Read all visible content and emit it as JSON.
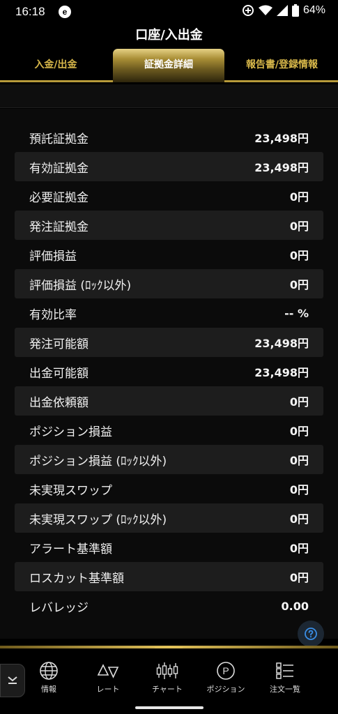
{
  "status": {
    "time": "16:18",
    "app_badge": "e",
    "battery": "64%"
  },
  "header": {
    "title": "口座/入出金"
  },
  "tabs": [
    {
      "label": "入金/出金"
    },
    {
      "label": "証拠金詳細"
    },
    {
      "label": "報告書/登録情報"
    }
  ],
  "rows": [
    {
      "label": "預託証拠金",
      "value": "23,498円"
    },
    {
      "label": "有効証拠金",
      "value": "23,498円"
    },
    {
      "label": "必要証拠金",
      "value": "0円"
    },
    {
      "label": "発注証拠金",
      "value": "0円"
    },
    {
      "label": "評価損益",
      "value": "0円"
    },
    {
      "label": "評価損益 (ﾛｯｸ以外)",
      "value": "0円"
    },
    {
      "label": "有効比率",
      "value": "-- %"
    },
    {
      "label": "発注可能額",
      "value": "23,498円"
    },
    {
      "label": "出金可能額",
      "value": "23,498円"
    },
    {
      "label": "出金依頼額",
      "value": "0円"
    },
    {
      "label": "ポジション損益",
      "value": "0円"
    },
    {
      "label": "ポジション損益 (ﾛｯｸ以外)",
      "value": "0円"
    },
    {
      "label": "未実現スワップ",
      "value": "0円"
    },
    {
      "label": "未実現スワップ (ﾛｯｸ以外)",
      "value": "0円"
    },
    {
      "label": "アラート基準額",
      "value": "0円"
    },
    {
      "label": "ロスカット基準額",
      "value": "0円"
    },
    {
      "label": "レバレッジ",
      "value": "0.00"
    }
  ],
  "nav": [
    {
      "label": "情報",
      "icon": "globe-icon"
    },
    {
      "label": "レート",
      "icon": "rate-icon"
    },
    {
      "label": "チャート",
      "icon": "candlestick-chart-icon"
    },
    {
      "label": "ポジション",
      "icon": "position-p-icon"
    },
    {
      "label": "注文一覧",
      "icon": "order-list-icon"
    }
  ],
  "colors": {
    "gold": "#d8b84a",
    "row_shade": "#1d1d1d",
    "background": "#000000",
    "help_blue": "#3a8ee6"
  }
}
